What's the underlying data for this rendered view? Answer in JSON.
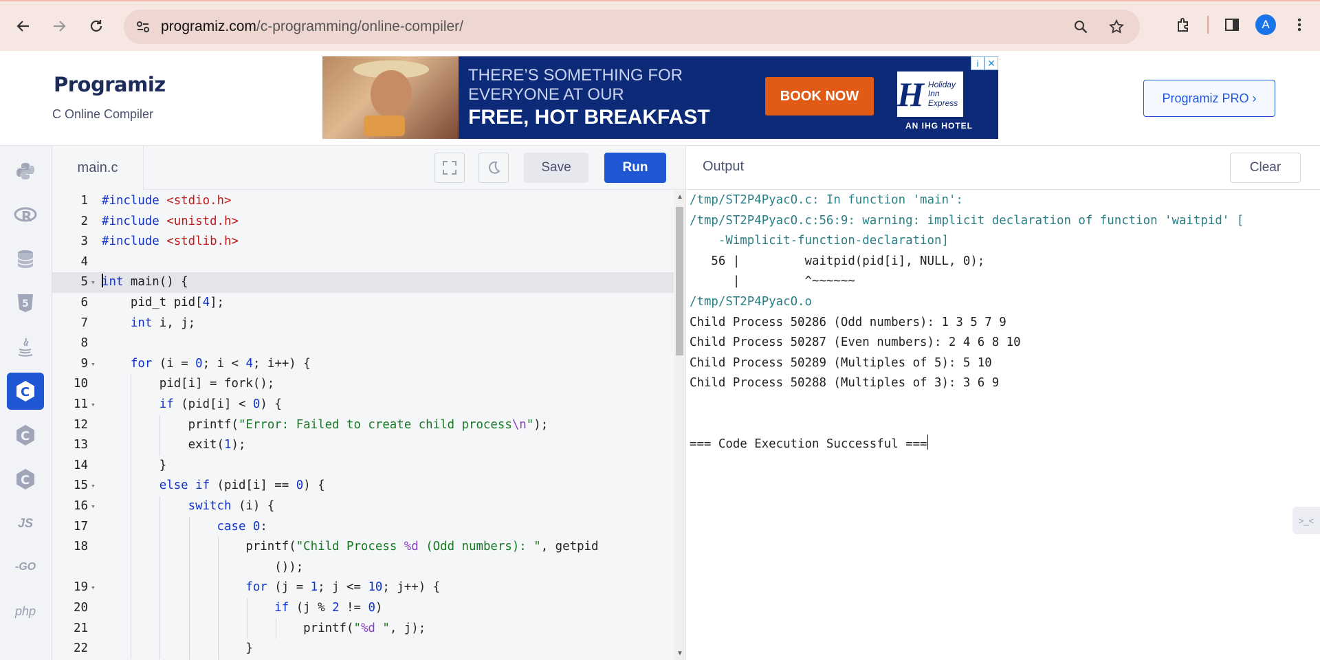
{
  "browser": {
    "url_host": "programiz.com",
    "url_path": "/c-programming/online-compiler/",
    "avatar_letter": "A"
  },
  "header": {
    "logo_text": "Programiz",
    "subtitle": "C Online Compiler",
    "pro_button": "Programiz PRO ›",
    "ad": {
      "line1": "THERE’S SOMETHING FOR",
      "line2": "EVERYONE AT OUR",
      "line3": "FREE, HOT BREAKFAST",
      "cta": "BOOK NOW",
      "brand": "Holiday Inn Express",
      "tagline": "AN IHG HOTEL"
    }
  },
  "sidebar": {
    "languages": [
      {
        "name": "python",
        "label": ""
      },
      {
        "name": "r",
        "label": "R"
      },
      {
        "name": "sql",
        "label": ""
      },
      {
        "name": "html",
        "label": "5"
      },
      {
        "name": "java",
        "label": ""
      },
      {
        "name": "c",
        "label": "C",
        "active": true
      },
      {
        "name": "cpp",
        "label": "C"
      },
      {
        "name": "csharp",
        "label": "C"
      },
      {
        "name": "js",
        "label": "JS"
      },
      {
        "name": "go",
        "label": "-GO"
      },
      {
        "name": "php",
        "label": "php"
      }
    ]
  },
  "editor": {
    "file_tab": "main.c",
    "save_label": "Save",
    "run_label": "Run",
    "lines": [
      {
        "n": "1",
        "fold": false,
        "indent": 0,
        "html": "<span class=\"inc\">#include</span> <span class=\"incf\">&lt;stdio.h&gt;</span>"
      },
      {
        "n": "2",
        "fold": false,
        "indent": 0,
        "html": "<span class=\"inc\">#include</span> <span class=\"incf\">&lt;unistd.h&gt;</span>"
      },
      {
        "n": "3",
        "fold": false,
        "indent": 0,
        "html": "<span class=\"inc\">#include</span> <span class=\"incf\">&lt;stdlib.h&gt;</span>"
      },
      {
        "n": "4",
        "fold": false,
        "indent": 0,
        "html": ""
      },
      {
        "n": "5",
        "fold": true,
        "indent": 0,
        "active": true,
        "html": "<span class=\"cursor\"></span><span class=\"k\">int</span> main() {"
      },
      {
        "n": "6",
        "fold": false,
        "indent": 1,
        "html": "    pid_t pid[<span class=\"n\">4</span>];"
      },
      {
        "n": "7",
        "fold": false,
        "indent": 1,
        "html": "    <span class=\"k\">int</span> i, j;"
      },
      {
        "n": "8",
        "fold": false,
        "indent": 0,
        "html": ""
      },
      {
        "n": "9",
        "fold": true,
        "indent": 1,
        "html": "    <span class=\"k\">for</span> (i = <span class=\"n\">0</span>; i &lt; <span class=\"n\">4</span>; i++) {"
      },
      {
        "n": "10",
        "fold": false,
        "indent": 2,
        "html": "        pid[i] = fork();"
      },
      {
        "n": "11",
        "fold": true,
        "indent": 2,
        "html": "        <span class=\"k\">if</span> (pid[i] &lt; <span class=\"n\">0</span>) {"
      },
      {
        "n": "12",
        "fold": false,
        "indent": 3,
        "html": "            printf(<span class=\"s\">\"Error: Failed to create child process</span><span class=\"e\">\\n</span><span class=\"s\">\"</span>);"
      },
      {
        "n": "13",
        "fold": false,
        "indent": 3,
        "html": "            exit(<span class=\"n\">1</span>);"
      },
      {
        "n": "14",
        "fold": false,
        "indent": 2,
        "html": "        }"
      },
      {
        "n": "15",
        "fold": true,
        "indent": 2,
        "html": "        <span class=\"k\">else if</span> (pid[i] == <span class=\"n\">0</span>) {"
      },
      {
        "n": "16",
        "fold": true,
        "indent": 3,
        "html": "            <span class=\"k\">switch</span> (i) {"
      },
      {
        "n": "17",
        "fold": false,
        "indent": 4,
        "html": "                <span class=\"k\">case</span> <span class=\"n\">0</span>:"
      },
      {
        "n": "18",
        "fold": false,
        "indent": 5,
        "html": "                    printf(<span class=\"s\">\"Child Process </span><span class=\"e\">%d</span><span class=\"s\"> (Odd numbers): \"</span>, getpid"
      },
      {
        "n": "",
        "fold": false,
        "indent": 5,
        "html": "                        ());"
      },
      {
        "n": "19",
        "fold": true,
        "indent": 5,
        "html": "                    <span class=\"k\">for</span> (j = <span class=\"n\">1</span>; j &lt;= <span class=\"n\">10</span>; j++) {"
      },
      {
        "n": "20",
        "fold": false,
        "indent": 6,
        "html": "                        <span class=\"k\">if</span> (j % <span class=\"n\">2</span> != <span class=\"n\">0</span>)"
      },
      {
        "n": "21",
        "fold": false,
        "indent": 7,
        "html": "                            printf(<span class=\"s\">\"</span><span class=\"e\">%d</span><span class=\"s\"> \"</span>, j);"
      },
      {
        "n": "22",
        "fold": false,
        "indent": 5,
        "html": "                    }"
      }
    ]
  },
  "output": {
    "title": "Output",
    "clear_label": "Clear",
    "lines": [
      {
        "text": "/tmp/ST2P4PyacO.c: In function 'main':",
        "style": "teal"
      },
      {
        "text": "/tmp/ST2P4PyacO.c:56:9: warning: implicit declaration of function 'waitpid' [",
        "style": "teal"
      },
      {
        "text": "    -Wimplicit-function-declaration]",
        "style": "teal"
      },
      {
        "text": "   56 |         waitpid(pid[i], NULL, 0);",
        "style": ""
      },
      {
        "text": "      |         ^~~~~~~",
        "style": ""
      },
      {
        "text": "/tmp/ST2P4PyacO.o",
        "style": "teal"
      },
      {
        "text": "Child Process 50286 (Odd numbers): 1 3 5 7 9",
        "style": ""
      },
      {
        "text": "Child Process 50287 (Even numbers): 2 4 6 8 10",
        "style": ""
      },
      {
        "text": "Child Process 50289 (Multiples of 5): 5 10",
        "style": ""
      },
      {
        "text": "Child Process 50288 (Multiples of 3): 3 6 9",
        "style": ""
      },
      {
        "text": "",
        "style": ""
      },
      {
        "text": "",
        "style": ""
      },
      {
        "text": "=== Code Execution Successful ===",
        "style": ""
      }
    ]
  }
}
